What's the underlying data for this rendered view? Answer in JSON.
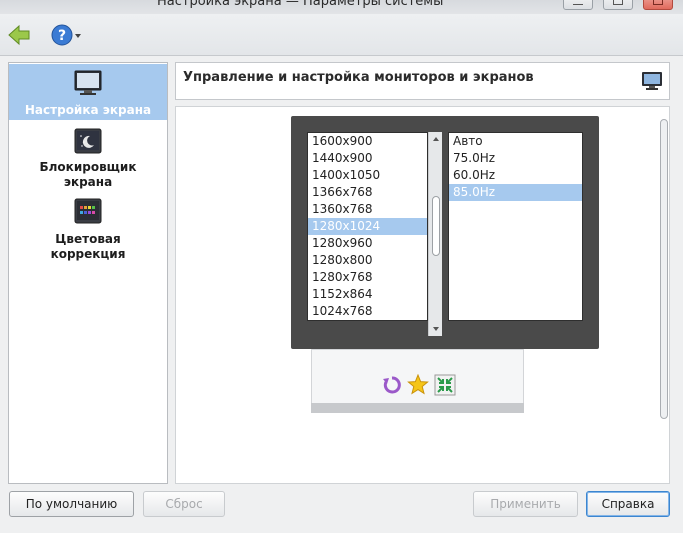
{
  "window": {
    "title": "Настройка экрана — Параметры системы"
  },
  "toolbar": {
    "back_icon": "back-arrow-icon",
    "help_icon": "help-icon"
  },
  "sidebar": {
    "items": [
      {
        "label": "Настройка экрана",
        "icon": "monitor-icon",
        "active": true
      },
      {
        "label_line1": "Блокировщик",
        "label_line2": "экрана",
        "icon": "screen-lock-icon"
      },
      {
        "label_line1": "Цветовая",
        "label_line2": "коррекция",
        "icon": "color-correction-icon"
      }
    ]
  },
  "header": {
    "title": "Управление и настройка мониторов и экранов"
  },
  "monitor": {
    "resolutions": [
      "1600x900",
      "1440x900",
      "1400x1050",
      "1366x768",
      "1360x768",
      "1280x1024",
      "1280x960",
      "1280x800",
      "1280x768",
      "1152x864",
      "1024x768"
    ],
    "selected_resolution": "1280x1024",
    "refresh_rates": [
      "Авто",
      "75.0Hz",
      "60.0Hz",
      "85.0Hz"
    ],
    "selected_refresh": "85.0Hz"
  },
  "footer": {
    "defaults": "По умолчанию",
    "reset": "Сброс",
    "apply": "Применить",
    "help": "Справка"
  },
  "colors": {
    "accent": "#a6c9ee",
    "monitor_frame": "#4a4a4a"
  }
}
